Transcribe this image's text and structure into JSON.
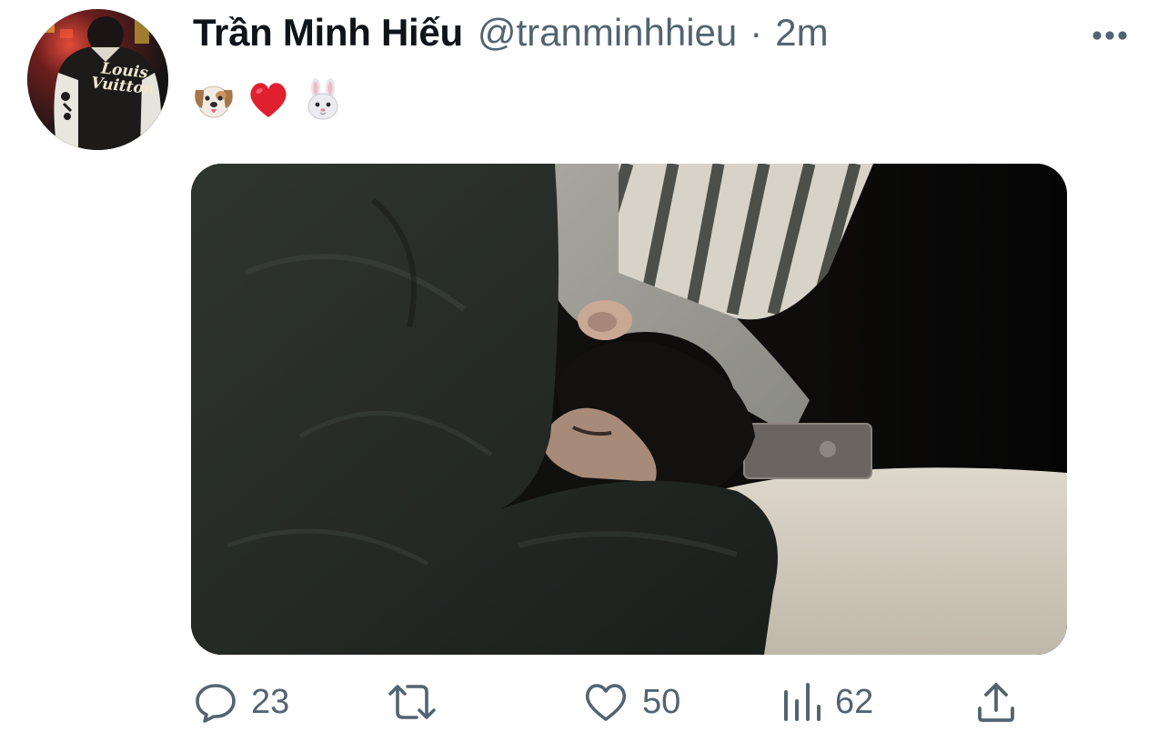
{
  "tweet": {
    "author": {
      "display_name": "Trần Minh Hiếu",
      "handle": "@tranminhhieu",
      "separator": "·",
      "time_ago": "2m",
      "avatar_logo_text": "Louis Vuitton"
    },
    "text_emojis": [
      "dog-face-emoji",
      "red-heart-emoji",
      "rabbit-face-emoji"
    ],
    "media": {
      "type": "photo",
      "icon": "photo"
    },
    "actions": {
      "reply_count": "23",
      "retweet_count": "",
      "like_count": "50",
      "views_count": "62"
    },
    "icons": {
      "more": "more-horizontal-icon",
      "reply": "reply-icon",
      "retweet": "retweet-icon",
      "like": "heart-icon",
      "views": "views-chart-icon",
      "share": "share-icon"
    },
    "colors": {
      "text_primary": "#0f1419",
      "text_secondary": "#536471",
      "heart_emoji": "#e0202e"
    }
  }
}
